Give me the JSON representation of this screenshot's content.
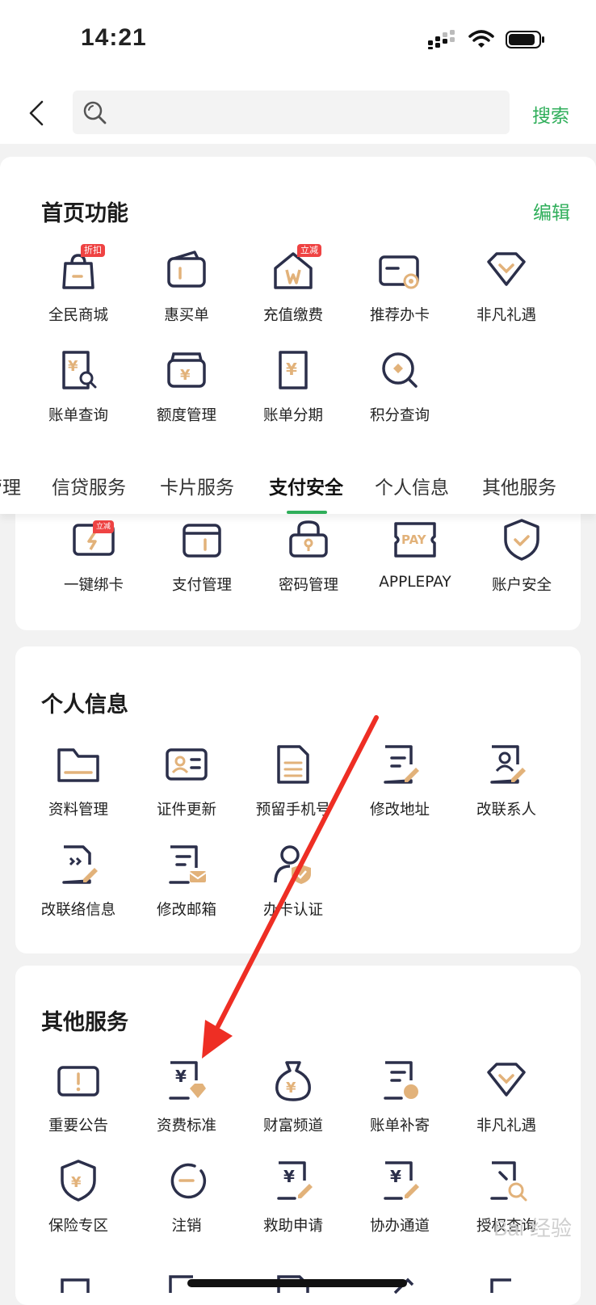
{
  "status": {
    "time": "14:21"
  },
  "search": {
    "placeholder": "",
    "button": "搜索"
  },
  "home": {
    "title": "首页功能",
    "edit": "编辑",
    "items": [
      {
        "label": "全民商城",
        "icon": "shopping-bag-icon",
        "badge": "折扣"
      },
      {
        "label": "惠买单",
        "icon": "wallet-icon"
      },
      {
        "label": "充值缴费",
        "icon": "house-recharge-icon",
        "badge": "立减"
      },
      {
        "label": "推荐办卡",
        "icon": "card-recommend-icon"
      },
      {
        "label": "非凡礼遇",
        "icon": "diamond-icon"
      },
      {
        "label": "账单查询",
        "icon": "bill-search-icon"
      },
      {
        "label": "额度管理",
        "icon": "wallet-yen-icon"
      },
      {
        "label": "账单分期",
        "icon": "bill-installment-icon"
      },
      {
        "label": "积分查询",
        "icon": "points-search-icon"
      }
    ]
  },
  "tabs": [
    "管理",
    "信贷服务",
    "卡片服务",
    "支付安全",
    "个人信息",
    "其他服务"
  ],
  "pay_security": {
    "items": [
      {
        "label": "一键绑卡",
        "icon": "card-bind-icon",
        "badge": "立减"
      },
      {
        "label": "支付管理",
        "icon": "wallet-icon"
      },
      {
        "label": "密码管理",
        "icon": "lock-icon"
      },
      {
        "label": "APPLEPAY",
        "icon": "applepay-icon"
      },
      {
        "label": "账户安全",
        "icon": "shield-check-icon"
      }
    ]
  },
  "personal": {
    "title": "个人信息",
    "items": [
      {
        "label": "资料管理",
        "icon": "folder-icon"
      },
      {
        "label": "证件更新",
        "icon": "id-card-icon"
      },
      {
        "label": "预留手机号",
        "icon": "phone-doc-icon"
      },
      {
        "label": "修改地址",
        "icon": "doc-edit-icon"
      },
      {
        "label": "改联系人",
        "icon": "contact-edit-icon"
      },
      {
        "label": "改联络信息",
        "icon": "contact-info-edit-icon"
      },
      {
        "label": "修改邮箱",
        "icon": "mail-doc-icon"
      },
      {
        "label": "办卡认证",
        "icon": "user-shield-icon"
      }
    ]
  },
  "other": {
    "title": "其他服务",
    "items": [
      {
        "label": "重要公告",
        "icon": "notice-icon"
      },
      {
        "label": "资费标准",
        "icon": "fee-doc-icon"
      },
      {
        "label": "财富频道",
        "icon": "money-bag-icon"
      },
      {
        "label": "账单补寄",
        "icon": "bill-resend-icon"
      },
      {
        "label": "非凡礼遇",
        "icon": "diamond-icon"
      },
      {
        "label": "保险专区",
        "icon": "insurance-shield-icon"
      },
      {
        "label": "注销",
        "icon": "cancel-circle-icon"
      },
      {
        "label": "救助申请",
        "icon": "aid-doc-icon"
      },
      {
        "label": "协办通道",
        "icon": "assist-doc-icon"
      },
      {
        "label": "授权查询",
        "icon": "auth-search-icon"
      }
    ]
  },
  "watermark": "Bai 经验",
  "colors": {
    "accent": "#2fae5a",
    "icon_dark": "#2b2f4a",
    "icon_gold": "#e2b27a",
    "badge": "#ef4343",
    "arrow": "#ee2e24"
  }
}
